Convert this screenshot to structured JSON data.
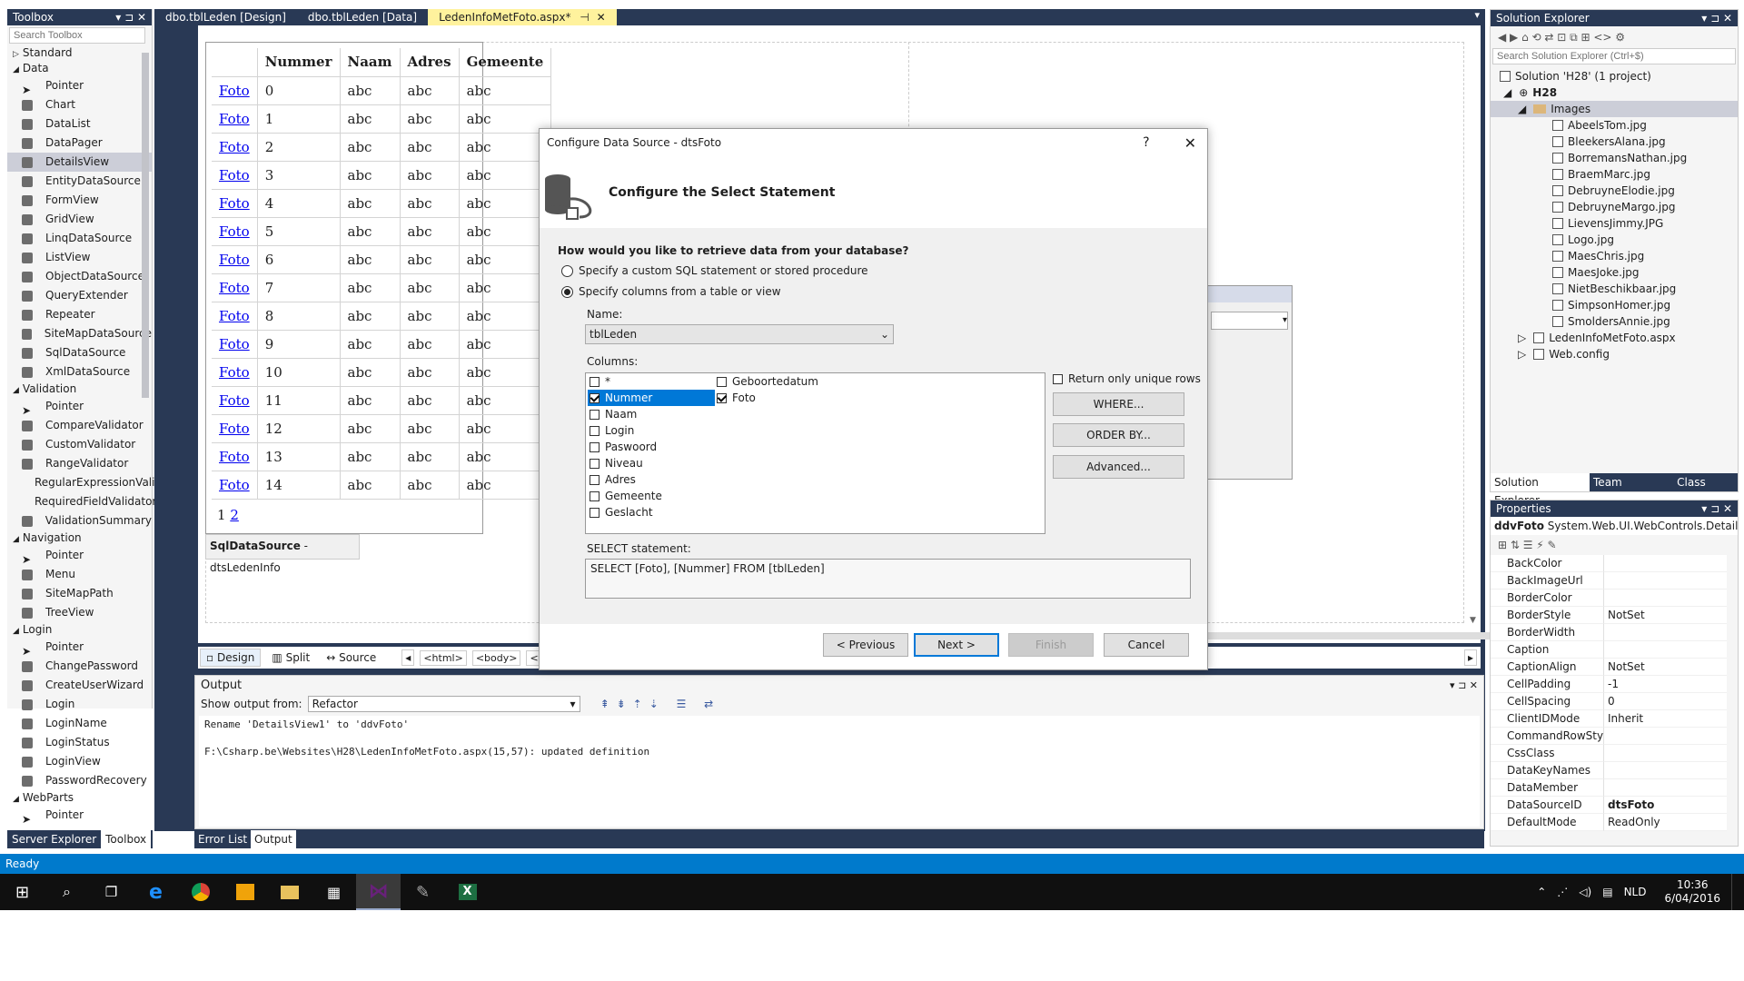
{
  "toolbox": {
    "title": "Toolbox",
    "search_placeholder": "Search Toolbox",
    "groups": [
      {
        "name": "Standard",
        "open": false,
        "items": []
      },
      {
        "name": "Data",
        "open": true,
        "items": [
          "Pointer",
          "Chart",
          "DataList",
          "DataPager",
          "DetailsView",
          "EntityDataSource",
          "FormView",
          "GridView",
          "LinqDataSource",
          "ListView",
          "ObjectDataSource",
          "QueryExtender",
          "Repeater",
          "SiteMapDataSource",
          "SqlDataSource",
          "XmlDataSource"
        ]
      },
      {
        "name": "Validation",
        "open": true,
        "items": [
          "Pointer",
          "CompareValidator",
          "CustomValidator",
          "RangeValidator",
          "RegularExpressionVali...",
          "RequiredFieldValidator",
          "ValidationSummary"
        ]
      },
      {
        "name": "Navigation",
        "open": true,
        "items": [
          "Pointer",
          "Menu",
          "SiteMapPath",
          "TreeView"
        ]
      },
      {
        "name": "Login",
        "open": true,
        "items": [
          "Pointer",
          "ChangePassword",
          "CreateUserWizard",
          "Login",
          "LoginName",
          "LoginStatus",
          "LoginView",
          "PasswordRecovery"
        ]
      },
      {
        "name": "WebParts",
        "open": true,
        "items": [
          "Pointer"
        ]
      }
    ],
    "selected": "DetailsView",
    "bottom_tabs": [
      "Server Explorer",
      "Toolbox"
    ]
  },
  "doc_tabs": [
    "dbo.tblLeden [Design]",
    "dbo.tblLeden [Data]",
    "LedenInfoMetFoto.aspx*"
  ],
  "grid": {
    "headers": [
      "",
      "Nummer",
      "Naam",
      "Adres",
      "Gemeente"
    ],
    "link": "Foto",
    "cell": "abc",
    "numbers": [
      "0",
      "1",
      "2",
      "3",
      "4",
      "5",
      "6",
      "7",
      "8",
      "9",
      "10",
      "11",
      "12",
      "13",
      "14"
    ],
    "pager1": "1",
    "pager2": "2",
    "datasource_label_bold": "SqlDataSource",
    "datasource_label_rest": " - dtsLedenInfo"
  },
  "designer_bar": {
    "design": "Design",
    "split": "Source",
    "split_label": "Split",
    "tags": [
      "<html>",
      "<body>",
      "<form#"
    ]
  },
  "output": {
    "title": "Output",
    "show_label": "Show output from:",
    "source": "Refactor",
    "lines": [
      "Rename 'DetailsView1' to 'ddvFoto'",
      "F:\\Csharp.be\\Websites\\H28\\LedenInfoMetFoto.aspx(15,57): updated definition"
    ],
    "tabs": [
      "Error List",
      "Output"
    ]
  },
  "dialog": {
    "title": "Configure Data Source - dtsFoto",
    "help": "?",
    "heading": "Configure the Select Statement",
    "question": "How would you like to retrieve data from your database?",
    "opt1": "Specify a custom SQL statement or stored procedure",
    "opt2": "Specify columns from a table or view",
    "name_label": "Name:",
    "name_value": "tblLeden",
    "columns_label": "Columns:",
    "col1": [
      {
        "n": "*",
        "c": false
      },
      {
        "n": "Nummer",
        "c": true
      },
      {
        "n": "Naam",
        "c": false
      },
      {
        "n": "Login",
        "c": false
      },
      {
        "n": "Paswoord",
        "c": false
      },
      {
        "n": "Niveau",
        "c": false
      },
      {
        "n": "Adres",
        "c": false
      },
      {
        "n": "Gemeente",
        "c": false
      },
      {
        "n": "Geslacht",
        "c": false
      }
    ],
    "col2": [
      {
        "n": "Geboortedatum",
        "c": false
      },
      {
        "n": "Foto",
        "c": true
      }
    ],
    "unique": "Return only unique rows",
    "where": "WHERE...",
    "orderby": "ORDER BY...",
    "advanced": "Advanced...",
    "select_label": "SELECT statement:",
    "select_value": "SELECT [Foto], [Nummer] FROM [tblLeden]",
    "prev": "< Previous",
    "next": "Next >",
    "finish": "Finish",
    "cancel": "Cancel"
  },
  "solution": {
    "title": "Solution Explorer",
    "search_placeholder": "Search Solution Explorer (Ctrl+$)",
    "solution": "Solution 'H28' (1 project)",
    "project": "H28",
    "folder": "Images",
    "files": [
      "AbeelsTom.jpg",
      "BleekersAlana.jpg",
      "BorremansNathan.jpg",
      "BraemMarc.jpg",
      "DebruyneElodie.jpg",
      "DebruyneMargo.jpg",
      "LievensJimmy.JPG",
      "Logo.jpg",
      "MaesChris.jpg",
      "MaesJoke.jpg",
      "NietBeschikbaar.jpg",
      "SimpsonHomer.jpg",
      "SmoldersAnnie.jpg"
    ],
    "aspx": "LedenInfoMetFoto.aspx",
    "config": "Web.config",
    "tabs": [
      "Solution Explorer",
      "Team Explorer",
      "Class View"
    ]
  },
  "properties": {
    "title": "Properties",
    "object_bold": "ddvFoto",
    "object_type": "System.Web.UI.WebControls.DetailsVi",
    "rows": [
      {
        "n": "BackColor",
        "v": ""
      },
      {
        "n": "BackImageUrl",
        "v": ""
      },
      {
        "n": "BorderColor",
        "v": ""
      },
      {
        "n": "BorderStyle",
        "v": "NotSet"
      },
      {
        "n": "BorderWidth",
        "v": ""
      },
      {
        "n": "Caption",
        "v": ""
      },
      {
        "n": "CaptionAlign",
        "v": "NotSet"
      },
      {
        "n": "CellPadding",
        "v": "-1"
      },
      {
        "n": "CellSpacing",
        "v": "0"
      },
      {
        "n": "ClientIDMode",
        "v": "Inherit"
      },
      {
        "n": "CommandRowStyle",
        "v": ""
      },
      {
        "n": "CssClass",
        "v": ""
      },
      {
        "n": "DataKeyNames",
        "v": ""
      },
      {
        "n": "DataMember",
        "v": ""
      },
      {
        "n": "DataSourceID",
        "v": "dtsFoto"
      },
      {
        "n": "DefaultMode",
        "v": "ReadOnly"
      }
    ]
  },
  "status": "Ready",
  "taskbar": {
    "lang": "NLD",
    "time": "10:36",
    "date": "6/04/2016"
  },
  "colors": {
    "vs_blue": "#293955",
    "status": "#007acc",
    "active_tab": "#fff29d",
    "taskbar": "#101010"
  }
}
